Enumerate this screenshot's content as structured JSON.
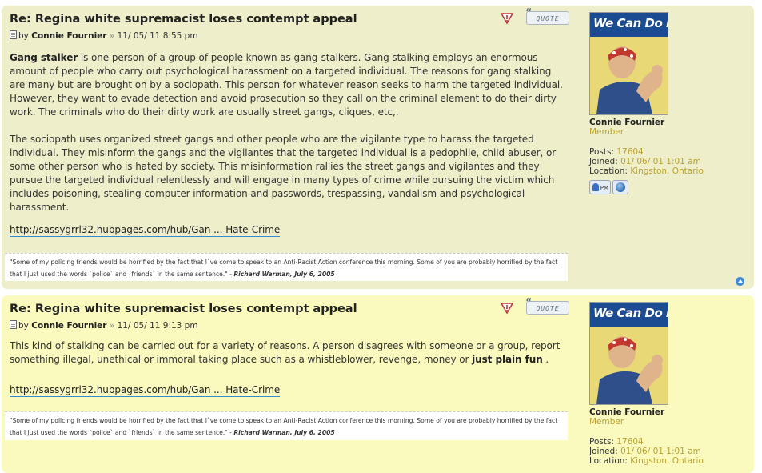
{
  "posts": [
    {
      "title": "Re: Regina white supremacist loses contempt appeal",
      "by_label": "by",
      "author": "Connie Fournier",
      "separator": "»",
      "date": "11/ 05/ 11 8:55 pm",
      "quote_label": "QUOTE",
      "paragraph_1_bold": "Gang stalker",
      "paragraph_1_rest": " is one person of a group of people known as gang-stalkers. Gang stalking employs an enormous amount of people who carry out psychological harassment on a targeted individual. The reasons for gang stalking are many but are brought on by a sociopath. This person for whatever reason seeks to harm the targeted individual. However, they want to evade detection and avoid prosecution so they call on the criminal element to do their dirty work. The criminals who do their dirty work are usually street gangs, cliques, etc,.",
      "paragraph_2": "The sociopath uses organized street gangs and other people who are the vigilante type to harass the targeted individual. They misinform the gangs and the vigilantes that the targeted individual is a pedophile, child abuser, or some other person who is hated by society. This misinformation rallies the street gangs and vigilantes and they pursue the targeted individual relentlessly and will engage in many types of crime while pursuing the victim which includes poisoning, stealing computer information and passwords, trespassing, vandalism and psychological harassment.",
      "link": "http://sassygrrl32.hubpages.com/hub/Gan ... Hate-Crime",
      "signature_text": "\"Some of my policing friends would be horrified by the fact that I`ve come to speak to an Anti-Racist Action conference this morning. Some of you are probably horrified by the fact that I just used the words `police` and `friends` in the same sentence.\" -",
      "signature_author": "Richard Warman, July 6, 2005"
    },
    {
      "title": "Re: Regina white supremacist loses contempt appeal",
      "by_label": "by",
      "author": "Connie Fournier",
      "separator": "»",
      "date": "11/ 05/ 11 9:13 pm",
      "quote_label": "QUOTE",
      "paragraph_1_text": "This kind of stalking can be carried out for a variety of reasons. A person disagrees with someone or a group, report something illegal, unethical or immoral taking place such as a whistleblower, revenge, money or ",
      "paragraph_1_bold": "just plain fun",
      "paragraph_1_end": " .",
      "link": "http://sassygrrl32.hubpages.com/hub/Gan ... Hate-Crime",
      "signature_text": "\"Some of my policing friends would be horrified by the fact that I`ve come to speak to an Anti-Racist Action conference this morning. Some of you are probably horrified by the fact that I just used the words `police` and `friends` in the same sentence.\" -",
      "signature_author": "Richard Warman, July 6, 2005"
    }
  ],
  "profile": {
    "avatar_text": "We Can Do It!",
    "name": "Connie Fournier",
    "rank": "Member",
    "posts_label": "Posts:",
    "posts_value": "17604",
    "joined_label": "Joined:",
    "joined_value": "01/ 06/ 01 1:01 am",
    "location_label": "Location:",
    "location_value": "Kingston, Ontario",
    "pm_label": "PM"
  },
  "icons": {
    "report": "report-warning-icon",
    "document": "post-document-icon",
    "top": "back-to-top-icon",
    "website": "website-globe-icon",
    "pm": "private-message-icon"
  },
  "colors": {
    "post_bg_1": "#eeeeca",
    "post_bg_2": "#fafabf",
    "accent_gold": "#b9a232",
    "link_underline": "#368ad2"
  }
}
